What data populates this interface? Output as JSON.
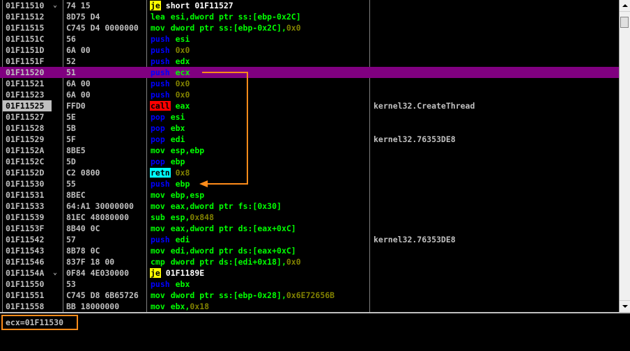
{
  "colors": {
    "selected_row_bg": "#800080",
    "push_pop": "#0000ff",
    "call_bg": "#ff0000",
    "jump_bg": "#ffff00",
    "ret_bg": "#00ffff",
    "register": "#00ff00",
    "number": "#808000",
    "highlight_box": "#ff8c1a",
    "jump_arrow": "#ff8c1a"
  },
  "rows": [
    {
      "addr": "01F11510",
      "arrow": "⌄",
      "hex": "74 15",
      "mnemonic": "je",
      "mtype": "jcc",
      "operands": [
        {
          "t": " short 01F11527",
          "k": "plain"
        }
      ],
      "comment": ""
    },
    {
      "addr": "01F11512",
      "arrow": "",
      "hex": "8D75 D4",
      "mnemonic": "lea",
      "mtype": "green",
      "operands": [
        {
          "t": " esi,",
          "k": "reg"
        },
        {
          "t": "dword ptr ss:[ebp-0x2C]",
          "k": "reg"
        }
      ],
      "comment": ""
    },
    {
      "addr": "01F11515",
      "arrow": "",
      "hex": "C745 D4 0000000",
      "mnemonic": "mov",
      "mtype": "green",
      "operands": [
        {
          "t": " dword ptr ss:[ebp-0x2C],",
          "k": "reg"
        },
        {
          "t": "0x0",
          "k": "num"
        }
      ],
      "comment": ""
    },
    {
      "addr": "01F1151C",
      "arrow": "",
      "hex": "56",
      "mnemonic": "push",
      "mtype": "pushpop",
      "operands": [
        {
          "t": " esi",
          "k": "reg"
        }
      ],
      "comment": ""
    },
    {
      "addr": "01F1151D",
      "arrow": "",
      "hex": "6A 00",
      "mnemonic": "push",
      "mtype": "pushpop",
      "operands": [
        {
          "t": " 0x0",
          "k": "num"
        }
      ],
      "comment": ""
    },
    {
      "addr": "01F1151F",
      "arrow": "",
      "hex": "52",
      "mnemonic": "push",
      "mtype": "pushpop",
      "operands": [
        {
          "t": " edx",
          "k": "reg"
        }
      ],
      "comment": ""
    },
    {
      "addr": "01F11520",
      "arrow": "",
      "hex": "51",
      "mnemonic": "push",
      "mtype": "pushpop",
      "operands": [
        {
          "t": " ecx",
          "k": "reg"
        }
      ],
      "comment": "",
      "selected": true
    },
    {
      "addr": "01F11521",
      "arrow": "",
      "hex": "6A 00",
      "mnemonic": "push",
      "mtype": "pushpop",
      "operands": [
        {
          "t": " 0x0",
          "k": "num"
        }
      ],
      "comment": ""
    },
    {
      "addr": "01F11523",
      "arrow": "",
      "hex": "6A 00",
      "mnemonic": "push",
      "mtype": "pushpop",
      "operands": [
        {
          "t": " 0x0",
          "k": "num"
        }
      ],
      "comment": ""
    },
    {
      "addr": "01F11525",
      "arrow": "",
      "hex": "FFD0",
      "mnemonic": "call",
      "mtype": "call",
      "operands": [
        {
          "t": " eax",
          "k": "reg"
        }
      ],
      "comment": "kernel32.CreateThread",
      "current": true
    },
    {
      "addr": "01F11527",
      "arrow": "",
      "hex": "5E",
      "mnemonic": "pop",
      "mtype": "pushpop",
      "operands": [
        {
          "t": " esi",
          "k": "reg"
        }
      ],
      "comment": ""
    },
    {
      "addr": "01F11528",
      "arrow": "",
      "hex": "5B",
      "mnemonic": "pop",
      "mtype": "pushpop",
      "operands": [
        {
          "t": " ebx",
          "k": "reg"
        }
      ],
      "comment": ""
    },
    {
      "addr": "01F11529",
      "arrow": "",
      "hex": "5F",
      "mnemonic": "pop",
      "mtype": "pushpop",
      "operands": [
        {
          "t": " edi",
          "k": "reg"
        }
      ],
      "comment": "kernel32.76353DE8"
    },
    {
      "addr": "01F1152A",
      "arrow": "",
      "hex": "8BE5",
      "mnemonic": "mov",
      "mtype": "green",
      "operands": [
        {
          "t": " esp,ebp",
          "k": "reg"
        }
      ],
      "comment": ""
    },
    {
      "addr": "01F1152C",
      "arrow": "",
      "hex": "5D",
      "mnemonic": "pop",
      "mtype": "pushpop",
      "operands": [
        {
          "t": " ebp",
          "k": "reg"
        }
      ],
      "comment": ""
    },
    {
      "addr": "01F1152D",
      "arrow": "",
      "hex": "C2 0800",
      "mnemonic": "retn",
      "mtype": "ret",
      "operands": [
        {
          "t": " 0x8",
          "k": "num"
        }
      ],
      "comment": ""
    },
    {
      "addr": "01F11530",
      "arrow": "",
      "hex": "55",
      "mnemonic": "push",
      "mtype": "pushpop",
      "operands": [
        {
          "t": " ebp",
          "k": "reg"
        }
      ],
      "comment": ""
    },
    {
      "addr": "01F11531",
      "arrow": "",
      "hex": "8BEC",
      "mnemonic": "mov",
      "mtype": "green",
      "operands": [
        {
          "t": " ebp,esp",
          "k": "reg"
        }
      ],
      "comment": ""
    },
    {
      "addr": "01F11533",
      "arrow": "",
      "hex": "64:A1 30000000",
      "mnemonic": "mov",
      "mtype": "green",
      "operands": [
        {
          "t": " eax,",
          "k": "reg"
        },
        {
          "t": "dword ptr fs:[0x30]",
          "k": "reg"
        }
      ],
      "comment": ""
    },
    {
      "addr": "01F11539",
      "arrow": "",
      "hex": "81EC 48080000",
      "mnemonic": "sub",
      "mtype": "green",
      "operands": [
        {
          "t": " esp,",
          "k": "reg"
        },
        {
          "t": "0x848",
          "k": "num"
        }
      ],
      "comment": ""
    },
    {
      "addr": "01F1153F",
      "arrow": "",
      "hex": "8B40 0C",
      "mnemonic": "mov",
      "mtype": "green",
      "operands": [
        {
          "t": " eax,dword ptr ds:[eax+0xC]",
          "k": "reg"
        }
      ],
      "comment": ""
    },
    {
      "addr": "01F11542",
      "arrow": "",
      "hex": "57",
      "mnemonic": "push",
      "mtype": "pushpop",
      "operands": [
        {
          "t": " edi",
          "k": "reg"
        }
      ],
      "comment": "kernel32.76353DE8"
    },
    {
      "addr": "01F11543",
      "arrow": "",
      "hex": "8B78 0C",
      "mnemonic": "mov",
      "mtype": "green",
      "operands": [
        {
          "t": " edi,dword ptr ds:[eax+0xC]",
          "k": "reg"
        }
      ],
      "comment": ""
    },
    {
      "addr": "01F11546",
      "arrow": "",
      "hex": "837F 18 00",
      "mnemonic": "cmp",
      "mtype": "green",
      "operands": [
        {
          "t": " dword ptr ds:[edi+0x18],",
          "k": "reg"
        },
        {
          "t": "0x0",
          "k": "num"
        }
      ],
      "comment": ""
    },
    {
      "addr": "01F1154A",
      "arrow": "⌄",
      "hex": "0F84 4E030000",
      "mnemonic": "je",
      "mtype": "jcc",
      "operands": [
        {
          "t": " 01F1189E",
          "k": "plain"
        }
      ],
      "comment": ""
    },
    {
      "addr": "01F11550",
      "arrow": "",
      "hex": "53",
      "mnemonic": "push",
      "mtype": "pushpop",
      "operands": [
        {
          "t": " ebx",
          "k": "reg"
        }
      ],
      "comment": ""
    },
    {
      "addr": "01F11551",
      "arrow": "",
      "hex": "C745 D8 6B65726",
      "mnemonic": "mov",
      "mtype": "green",
      "operands": [
        {
          "t": " dword ptr ss:[ebp-0x28],",
          "k": "reg"
        },
        {
          "t": "0x6E72656B",
          "k": "num"
        }
      ],
      "comment": ""
    },
    {
      "addr": "01F11558",
      "arrow": "",
      "hex": "BB 18000000",
      "mnemonic": "mov",
      "mtype": "green",
      "operands": [
        {
          "t": " ebx,",
          "k": "reg"
        },
        {
          "t": "0x18",
          "k": "num"
        }
      ],
      "comment": ""
    }
  ],
  "info_panel": {
    "text": "ecx=01F11530"
  }
}
